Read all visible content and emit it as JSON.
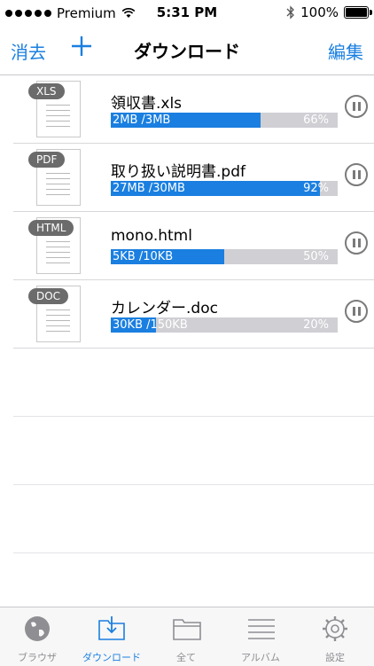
{
  "status_bar": {
    "carrier": "Premium",
    "time": "5:31 PM",
    "battery": "100%"
  },
  "nav": {
    "left_label": "消去",
    "title": "ダウンロード",
    "right_label": "編集"
  },
  "downloads": [
    {
      "type": "XLS",
      "name": "領収書.xls",
      "size": "2MB /3MB",
      "percent": "66%",
      "progress": 0.66
    },
    {
      "type": "PDF",
      "name": "取り扱い説明書.pdf",
      "size": "27MB /30MB",
      "percent": "92%",
      "progress": 0.92
    },
    {
      "type": "HTML",
      "name": "mono.html",
      "size": "5KB /10KB",
      "percent": "50%",
      "progress": 0.5
    },
    {
      "type": "DOC",
      "name": "カレンダー.doc",
      "size": "30KB /150KB",
      "percent": "20%",
      "progress": 0.2
    }
  ],
  "tabs": [
    {
      "label": "ブラウザ",
      "icon": "globe-icon",
      "active": false
    },
    {
      "label": "ダウンロード",
      "icon": "download-folder-icon",
      "active": true
    },
    {
      "label": "全て",
      "icon": "folder-icon",
      "active": false
    },
    {
      "label": "アルバム",
      "icon": "list-icon",
      "active": false
    },
    {
      "label": "設定",
      "icon": "gear-icon",
      "active": false
    }
  ],
  "colors": {
    "accent": "#1a7fe0",
    "progress_track": "#cfcfd4",
    "badge": "#6b6b6b"
  }
}
